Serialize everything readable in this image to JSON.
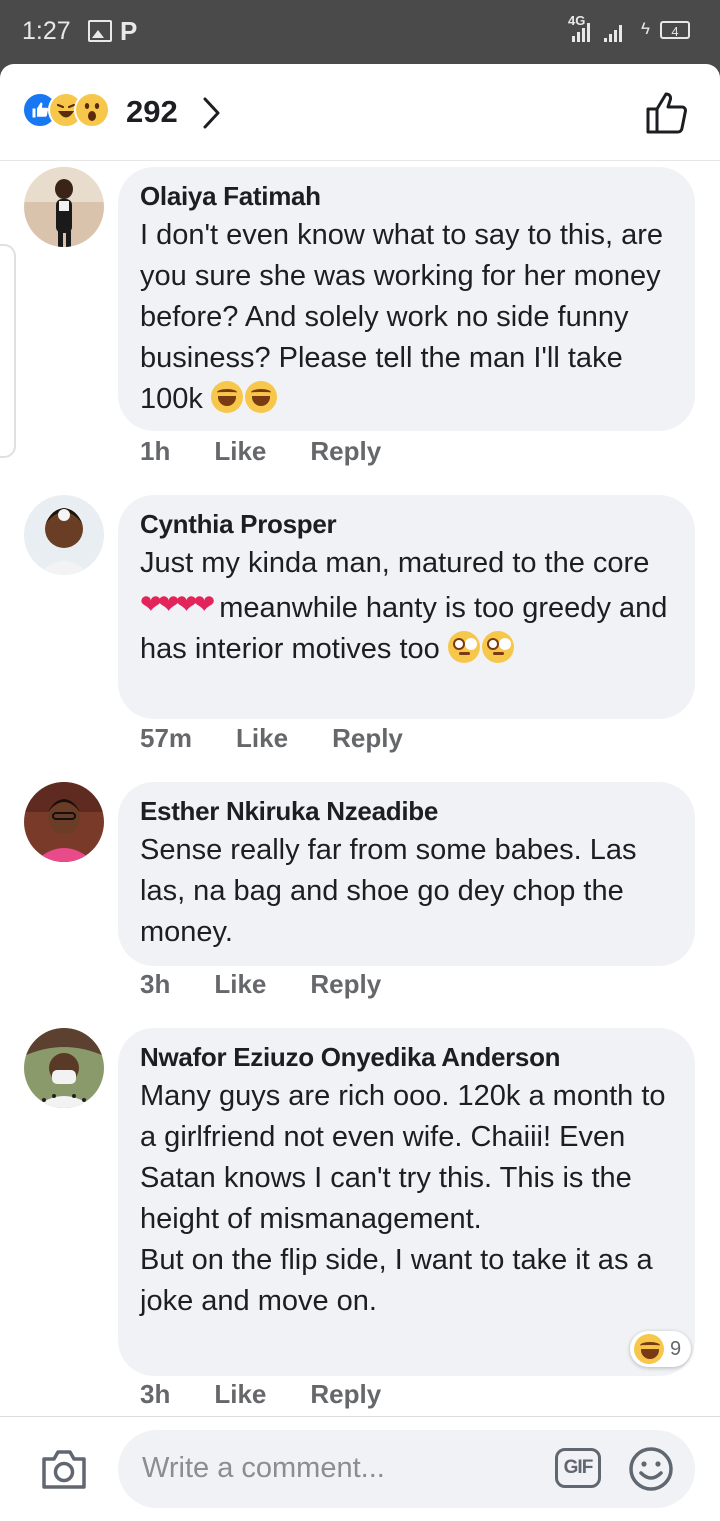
{
  "status_bar": {
    "time": "1:27",
    "network": "4G",
    "battery": "4"
  },
  "header": {
    "reaction_count": "292",
    "reactions": [
      "like",
      "haha",
      "wow"
    ]
  },
  "comments": [
    {
      "author": "Olaiya Fatimah",
      "text": "I don't even know what to say to this, are you sure she was working for her money before? And solely work no side funny business? Please tell the man I'll take 100k",
      "time": "1h",
      "like": "Like",
      "reply": "Reply"
    },
    {
      "author": "Cynthia Prosper",
      "text_a": "Just my kinda man, matured to the core",
      "text_b": " meanwhile hanty is too greedy and has interior motives too",
      "time": "57m",
      "like": "Like",
      "reply": "Reply"
    },
    {
      "author": "Esther Nkiruka Nzeadibe",
      "text": "Sense really far from some babes. Las las, na bag and shoe go dey chop the money.",
      "time": "3h",
      "like": "Like",
      "reply": "Reply"
    },
    {
      "author": "Nwafor Eziuzo Onyedika Anderson",
      "text_a": "Many guys are rich ooo. 120k a month to a girlfriend not even wife. Chaiii! Even Satan knows I can't try this. This is the height of mismanagement.",
      "text_b": "But on the flip side, I want to take it as a joke and move on.",
      "time": "3h",
      "like": "Like",
      "reply": "Reply",
      "reaction_badge_count": "9"
    }
  ],
  "composer": {
    "placeholder": "Write a comment...",
    "gif_label": "GIF"
  }
}
